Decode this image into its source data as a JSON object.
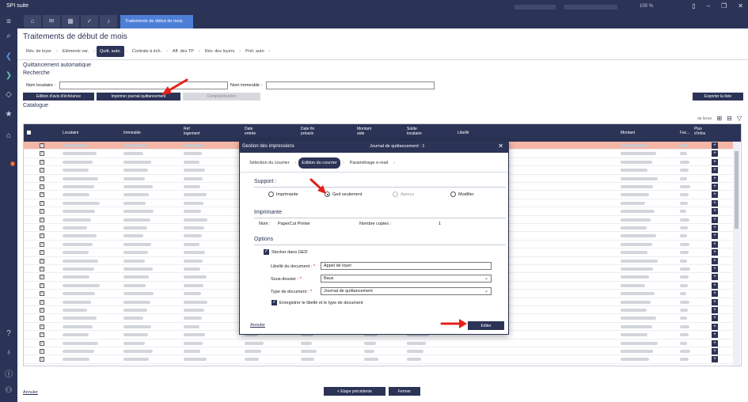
{
  "app": {
    "name": "SPI suite",
    "zoom": "100 %"
  },
  "tabs": {
    "active_label": "Traitements de début de mois"
  },
  "page": {
    "title": "Traitements de début de mois"
  },
  "steps": [
    {
      "label": "Rév. de loyer"
    },
    {
      "label": "Eléments var."
    },
    {
      "label": "Quitt. auto."
    },
    {
      "label": "Contrats à éch."
    },
    {
      "label": "Aff. des TP"
    },
    {
      "label": "Rév. des loyers"
    },
    {
      "label": "Prél. auto"
    }
  ],
  "section": {
    "title": "Quittancement automatique",
    "search_title": "Recherche"
  },
  "search": {
    "locataire_label": "Nom locataire :",
    "locataire_value": "",
    "immeuble_label": "Nom immeuble :",
    "immeuble_value": ""
  },
  "actions": {
    "edition_avis": "Edition d'avis d'échéance",
    "imprimer_journal": "Imprimer journal quittancement",
    "comptabilisation": "Comptabilisation",
    "exporter": "Exporter la liste"
  },
  "catalogue": {
    "title": "Catalogue",
    "count": "55 fiches",
    "columns": {
      "locataire": "Locataire",
      "immeuble": "Immeuble",
      "ref_logement": [
        "Ref",
        "logement"
      ],
      "date_entree": [
        "Date",
        "entrée"
      ],
      "date_fin": [
        "Date fin",
        "préavis"
      ],
      "montant_aide": [
        "Montant",
        "aide"
      ],
      "solde_locataire": [
        "Solde",
        "locataire"
      ],
      "libelle": "Libellé",
      "montant": "Montant",
      "fac": "Fac...",
      "plus_infos": [
        "Plus",
        "d'infos"
      ]
    }
  },
  "footer": {
    "annuler": "Annuler",
    "etape_precedente": "< Etape précédente",
    "fermer": "Fermer"
  },
  "modal": {
    "title": "Gestion des impressions",
    "subtitle": "Journal de quittancement : 1",
    "steps": [
      {
        "label": "Sélection du courrier"
      },
      {
        "label": "Edition du courrier"
      },
      {
        "label": "Paramétrage e-mail"
      }
    ],
    "support": {
      "title": "Support :",
      "options": [
        "Imprimante",
        "Ged seulement",
        "Aperçu",
        "Modifier"
      ],
      "selected": "Ged seulement"
    },
    "imprimante": {
      "title": "Imprimante",
      "nom_label": "Nom :",
      "nom_value": "PaperCut Printer",
      "copies_label": "Nombre copies :",
      "copies_value": "1"
    },
    "options": {
      "title": "Options",
      "stocker_label": "Stocker dans GED",
      "libelle_label": "Libellé du document :",
      "libelle_value": "Appel de loyer",
      "sous_dossier_label": "Sous-dossier :",
      "sous_dossier_value": "Baux",
      "type_label": "Type de document :",
      "type_value": "Journal de quittancement",
      "enregistrer_label": "Enregistrer le libellé et le type de document"
    },
    "annuler": "Annuler",
    "editer": "Editer"
  },
  "colors": {
    "navy": "#2b3356",
    "accent": "#4e7fd8",
    "highlight_row": "#f4b6a5",
    "arrow": "#e3201b"
  }
}
